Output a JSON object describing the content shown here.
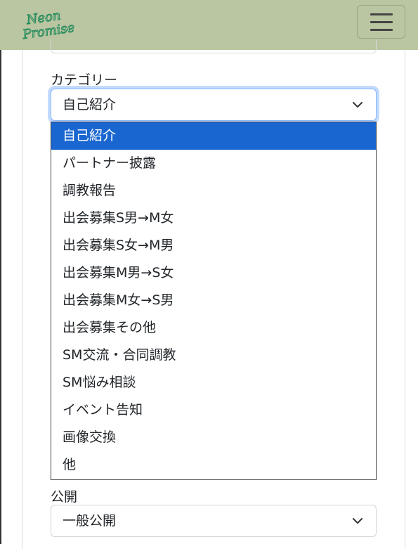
{
  "header": {
    "logo_text": "Neon Promise",
    "menu_icon": "hamburger-icon"
  },
  "form": {
    "category_label": "カテゴリー",
    "category_value": "自己紹介",
    "category_options": [
      "自己紹介",
      "パートナー披露",
      "調教報告",
      "出会募集S男→M女",
      "出会募集S女→M男",
      "出会募集M男→S女",
      "出会募集M女→S男",
      "出会募集その他",
      "SM交流・合同調教",
      "SM悩み相談",
      "イベント告知",
      "画像交換",
      "他"
    ],
    "visibility_label": "公開",
    "visibility_value": "一般公開"
  },
  "colors": {
    "navbar": "#bac5a1",
    "logo": "#1f8a5a",
    "selected_option": "#1a66d0",
    "focus_ring": "#86b7fe"
  }
}
